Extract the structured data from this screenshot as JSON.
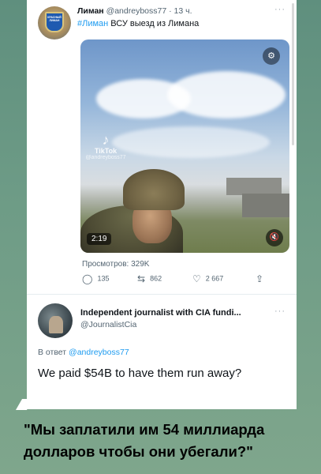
{
  "tweet": {
    "author_name": "Лиман",
    "author_handle": "@andreyboss77",
    "separator": "·",
    "time": "13 ч.",
    "text_hashtag": "#Лиман",
    "text_body": " ВСУ выезд из Лимана",
    "video": {
      "duration": "2:19",
      "tiktok_label": "TikTok",
      "tiktok_user": "@andreyboss77"
    },
    "views": "Просмотров: 329K",
    "actions": {
      "replies": "135",
      "retweets": "862",
      "likes": "2 667"
    },
    "avatar_text": "КРАСНЫЙ ЛИМАН"
  },
  "reply": {
    "author_name": "Independent journalist with CIA fundi...",
    "author_handle": "@JournalistCia",
    "reply_to_prefix": "В ответ ",
    "reply_to_handle": "@andreyboss77",
    "text": "We paid $54B to have them run away?"
  },
  "caption": "\"Мы заплатили им 54 миллиарда долларов чтобы они убегали?\"",
  "icons": [
    "more-dots-icon",
    "settings-icon",
    "tiktok-icon",
    "mute-icon",
    "reply-icon",
    "retweet-icon",
    "like-icon",
    "share-icon"
  ],
  "colors": {
    "link": "#1d9bf0",
    "text_primary": "#0f1419",
    "text_secondary": "#536471",
    "background": "#6d9b86"
  }
}
